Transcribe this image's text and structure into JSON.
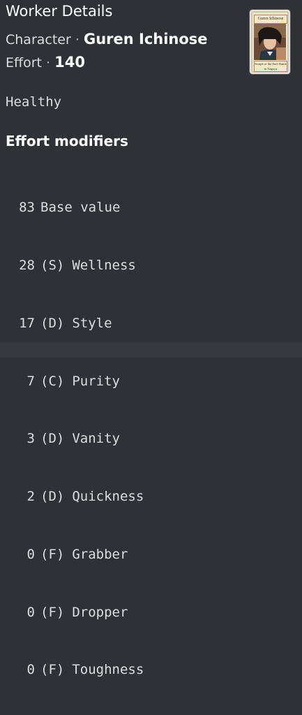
{
  "embed": {
    "title": "Worker Details",
    "character_label": "Character",
    "character_sep": "·",
    "character_name": "Guren Ichinose",
    "effort_label": "Effort",
    "effort_sep": "·",
    "effort_value": "140",
    "status": "Healthy",
    "modifiers_heading": "Effort modifiers",
    "modifiers": [
      {
        "value": "83",
        "grade": "",
        "name": "Base value"
      },
      {
        "value": "28",
        "grade": "(S)",
        "name": "Wellness"
      },
      {
        "value": "17",
        "grade": "(D)",
        "name": "Style"
      },
      {
        "value": "7",
        "grade": "(C)",
        "name": "Purity"
      },
      {
        "value": "3",
        "grade": "(D)",
        "name": "Vanity"
      },
      {
        "value": "2",
        "grade": "(D)",
        "name": "Quickness"
      },
      {
        "value": "0",
        "grade": "(F)",
        "name": "Grabber"
      },
      {
        "value": "0",
        "grade": "(F)",
        "name": "Dropper"
      },
      {
        "value": "0",
        "grade": "(F)",
        "name": "Toughness"
      }
    ],
    "card": {
      "name": "Guren Ichinose",
      "series": "Seraph of the End: Battle in Nagoya"
    }
  },
  "colors": {
    "background": "#2f3136",
    "text": "#dcddde",
    "heading": "#ffffff"
  }
}
